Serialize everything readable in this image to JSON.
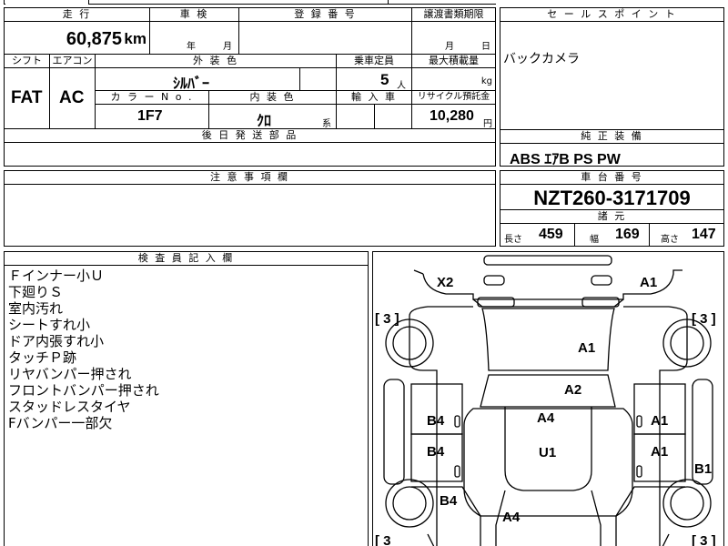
{
  "top_fragment": "",
  "header_left": {
    "mileage_label": "走 行",
    "mileage_value": "60,875",
    "mileage_unit": "km",
    "inspection_label": "車 検",
    "inspection_year_unit": "年",
    "inspection_month_unit": "月",
    "registration_label": "登 録 番 号",
    "registration_value": "",
    "transfer_label": "譲渡書類期限",
    "transfer_month_unit": "月",
    "transfer_day_unit": "日"
  },
  "specs": {
    "shift_label": "シフト",
    "shift_value": "FAT",
    "ac_label": "エアコン",
    "ac_value": "AC",
    "exterior_color_label": "外 装 色",
    "exterior_color_value": "ｼﾙﾊﾞｰ",
    "capacity_label": "乗車定員",
    "capacity_value": "5",
    "capacity_unit": "人",
    "max_load_label": "最大積載量",
    "max_load_unit": "kg",
    "color_no_label": "カ ラ ー N o .",
    "color_no_value": "1F7",
    "interior_color_label": "内 装 色",
    "interior_color_value": "ｸﾛ",
    "interior_color_suffix": "系",
    "import_label": "輸 入 車",
    "recycle_label": "リサイクル預託金",
    "recycle_value": "10,280",
    "recycle_unit": "円",
    "later_parts_label": "後 日 発 送 部 品"
  },
  "sales_point": {
    "label": "セ ー ル ス ポ イ ン ト",
    "value": "バックカメラ"
  },
  "equipment": {
    "label": "純 正 装 備",
    "value": "ABS ｴｱB PS PW"
  },
  "notes": {
    "label": "注 意 事 項 欄"
  },
  "chassis": {
    "label": "車 台 番 号",
    "value": "NZT260-3171709",
    "dims_label": "諸 元",
    "length_label": "長さ",
    "length_value": "459",
    "width_label": "幅",
    "width_value": "169",
    "height_label": "高さ",
    "height_value": "147"
  },
  "inspector": {
    "label": "検 査 員 記 入 欄",
    "lines": [
      "Ｆインナー小Ｕ",
      "下廻りＳ",
      "室内汚れ",
      "シートすれ小",
      "ドア内張すれ小",
      "タッチＰ跡",
      "リヤバンパー押され",
      "フロントバンパー押され",
      "スタッドレスタイヤ",
      "Fバンパー一部欠"
    ]
  },
  "diagram": {
    "marks": {
      "front_left": "X2",
      "front_right": "A1",
      "hood": "A1",
      "windshield": "A2",
      "roof": "A4",
      "cabin": "U1",
      "rear": "A4",
      "left_front_door": "B4",
      "left_rear_door": "B4",
      "left_quarter": "B4",
      "right_front_door": "A1",
      "right_rear_door": "A1",
      "right_rear_panel": "B1"
    },
    "tires": {
      "front_left": "[ 3 ]",
      "front_right": "[ 3 ]",
      "rear_left": "[ 3",
      "rear_right": "[ 3 ]"
    }
  }
}
